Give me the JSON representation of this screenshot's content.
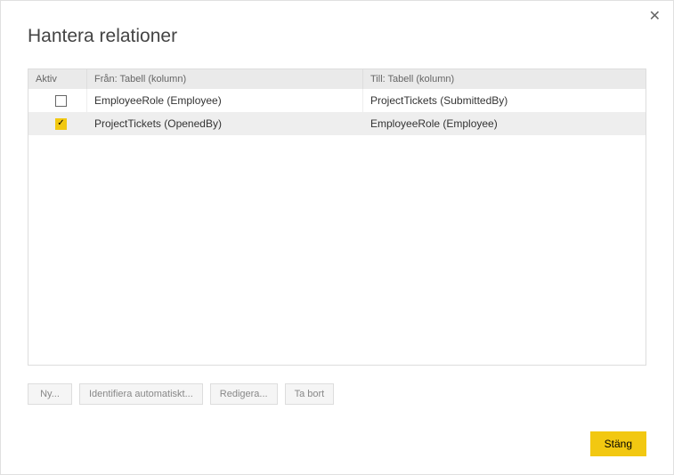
{
  "dialog": {
    "title": "Hantera relationer",
    "close_label": "✕"
  },
  "table": {
    "headers": {
      "active": "Aktiv",
      "from": "Från: Tabell (kolumn)",
      "to": "Till: Tabell (kolumn)"
    },
    "rows": [
      {
        "active": false,
        "from": "EmployeeRole (Employee)",
        "to": "ProjectTickets (SubmittedBy)",
        "selected": false
      },
      {
        "active": true,
        "from": "ProjectTickets (OpenedBy)",
        "to": "EmployeeRole (Employee)",
        "selected": true
      }
    ]
  },
  "buttons": {
    "new": "Ny...",
    "autodetect": "Identifiera automatiskt...",
    "edit": "Redigera...",
    "delete": "Ta bort",
    "close": "Stäng"
  }
}
